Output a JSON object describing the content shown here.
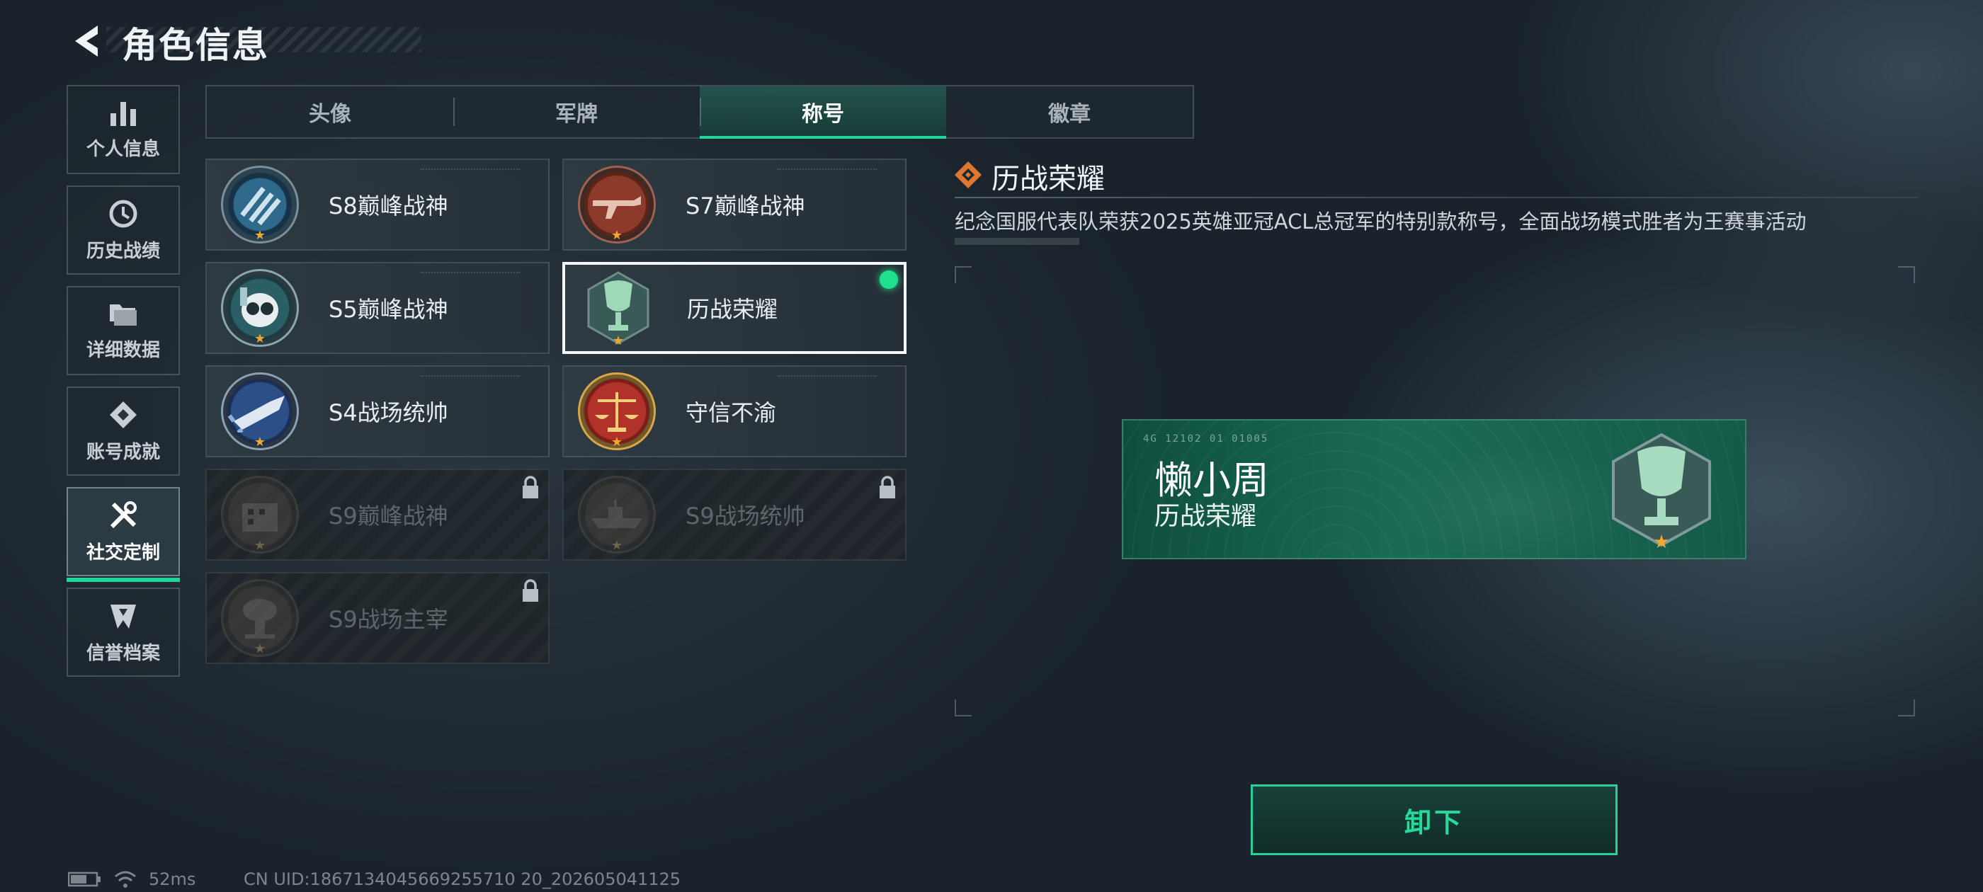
{
  "header": {
    "title": "角色信息"
  },
  "nav": {
    "items": [
      {
        "label": "个人信息",
        "icon": "bar-chart-icon"
      },
      {
        "label": "历史战绩",
        "icon": "history-icon"
      },
      {
        "label": "详细数据",
        "icon": "folders-icon"
      },
      {
        "label": "账号成就",
        "icon": "achievement-icon"
      },
      {
        "label": "社交定制",
        "icon": "tools-icon",
        "active": true
      },
      {
        "label": "信誉档案",
        "icon": "credit-shield-icon"
      }
    ]
  },
  "tabs": [
    {
      "label": "头像"
    },
    {
      "label": "军牌"
    },
    {
      "label": "称号",
      "active": true
    },
    {
      "label": "徽章"
    }
  ],
  "titles": [
    {
      "name": "S8巅峰战神",
      "icon": "stripes-emblem-icon",
      "locked": false
    },
    {
      "name": "S7巅峰战神",
      "icon": "rifle-emblem-icon",
      "locked": false
    },
    {
      "name": "S5巅峰战神",
      "icon": "skull-goggles-emblem-icon",
      "locked": false
    },
    {
      "name": "历战荣耀",
      "icon": "trophy-emblem-icon",
      "locked": false,
      "selected": true
    },
    {
      "name": "S4战场统帅",
      "icon": "missile-emblem-icon",
      "locked": false
    },
    {
      "name": "守信不渝",
      "icon": "scales-emblem-icon",
      "locked": false
    },
    {
      "name": "S9巅峰战神",
      "icon": "building-emblem-icon",
      "locked": true
    },
    {
      "name": "S9战场统帅",
      "icon": "warship-emblem-icon",
      "locked": true
    },
    {
      "name": "S9战场主宰",
      "icon": "mushroom-cloud-emblem-icon",
      "locked": true
    }
  ],
  "detail": {
    "title": "历战荣耀",
    "description": "纪念国服代表队荣获2025英雄亚冠ACL总冠军的特别款称号，全面战场模式胜者为王赛事活动"
  },
  "preview": {
    "code": "4G 12102  01 01005",
    "player_name": "懒小周",
    "title": "历战荣耀"
  },
  "actions": {
    "unequip_label": "卸下"
  },
  "status": {
    "ping": "52ms",
    "uid": "CN UID:1867134045669255710 20_202605041125"
  },
  "colors": {
    "accent": "#22d39a",
    "plate": "#1a6b56",
    "star": "#f0a830"
  }
}
